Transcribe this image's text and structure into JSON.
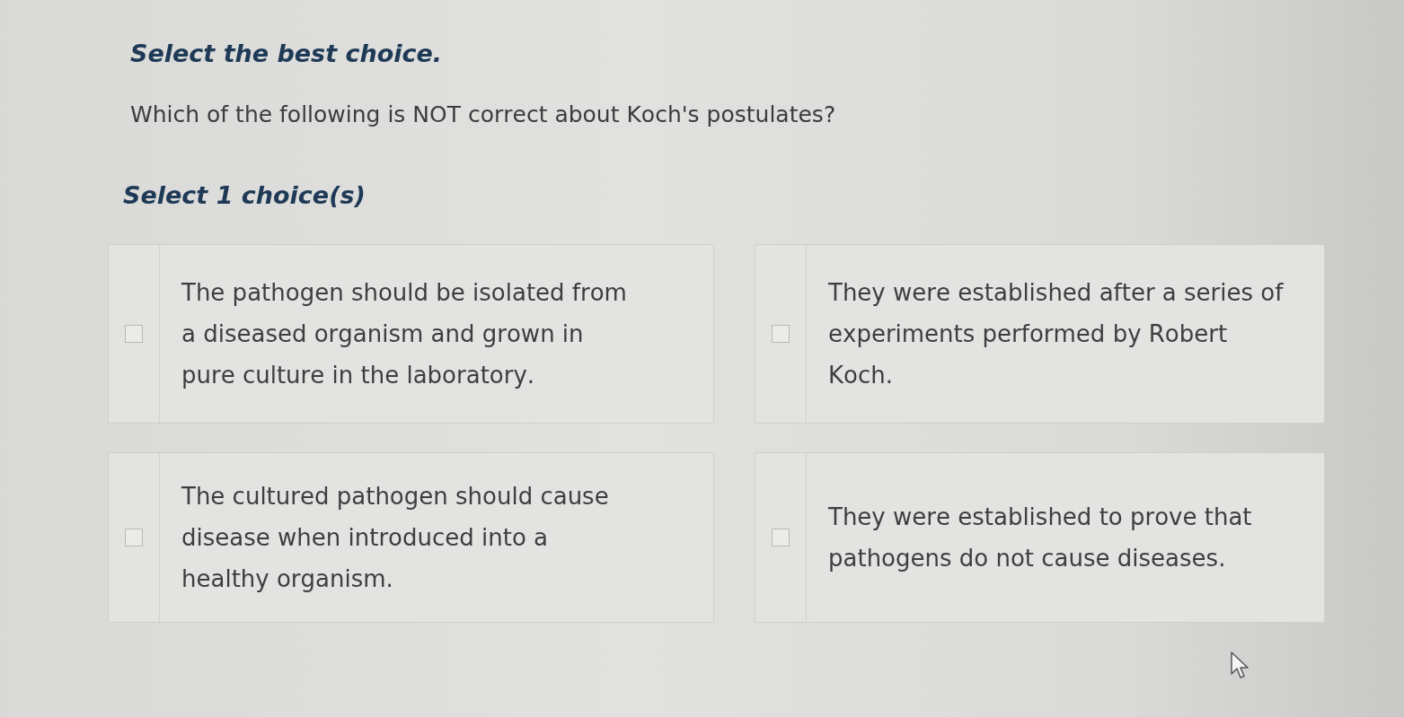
{
  "instruction": "Select the best choice.",
  "question": "Which of the following is NOT correct about Koch's postulates?",
  "selection_hint": "Select 1 choice(s)",
  "choices": [
    {
      "text": "The pathogen should be isolated from a diseased organism and grown in pure culture in the laboratory.",
      "checked": false
    },
    {
      "text": "They were established after a series of experiments performed by Robert Koch.",
      "checked": false
    },
    {
      "text": "The cultured pathogen should cause disease when introduced into a healthy organism.",
      "checked": false
    },
    {
      "text": "They were established to prove that pathogens do not cause diseases.",
      "checked": false
    }
  ]
}
